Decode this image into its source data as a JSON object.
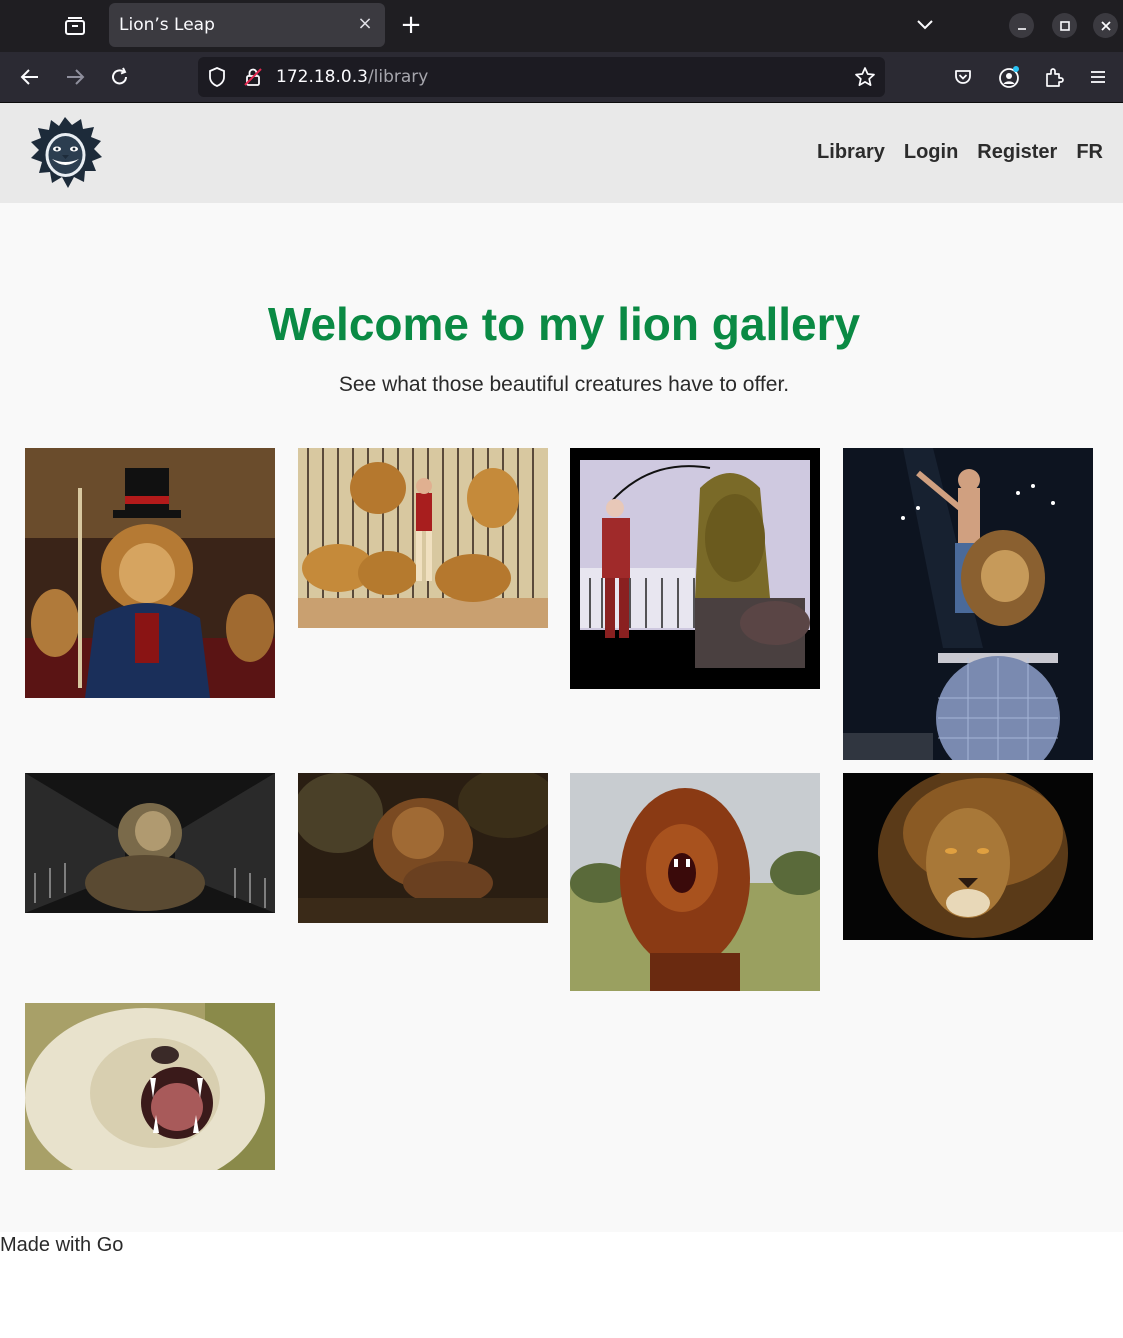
{
  "browser": {
    "tab_title": "Lion’s Leap",
    "tab_close": "×",
    "new_tab": "+",
    "url_host": "172.18.0.3",
    "url_path": "/library"
  },
  "site": {
    "nav": {
      "library": "Library",
      "login": "Login",
      "register": "Register",
      "lang": "FR"
    },
    "hero_title": "Welcome to my lion gallery",
    "hero_subtitle": "See what those beautiful creatures have to offer.",
    "footer_text": "Made with Go"
  },
  "icons": {
    "tab_list": "tab-list-icon",
    "back": "back-arrow-icon",
    "forward": "forward-arrow-icon",
    "reload": "reload-icon",
    "shield": "tracking-shield-icon",
    "lock": "insecure-lock-icon",
    "bookmark": "star-icon",
    "pocket": "pocket-icon",
    "account": "account-icon",
    "extensions": "extensions-icon",
    "menu": "hamburger-menu-icon"
  },
  "colors": {
    "heading": "#0a8a44",
    "header_bg": "#e9e9e9",
    "page_bg": "#f9f9f9"
  }
}
